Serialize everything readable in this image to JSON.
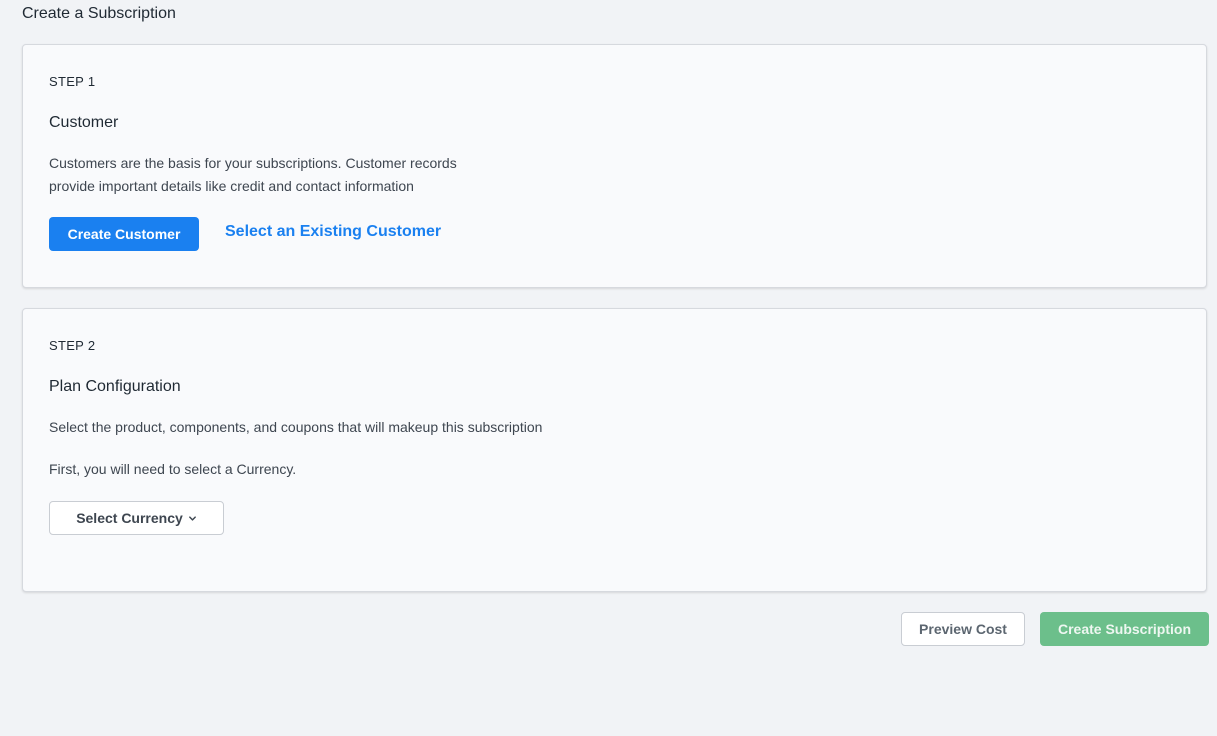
{
  "page": {
    "title": "Create a Subscription"
  },
  "step1": {
    "label": "STEP 1",
    "title": "Customer",
    "description_line1": "Customers are the basis for your subscriptions. Customer records",
    "description_line2": "provide important details like credit and contact information",
    "create_button": "Create Customer",
    "select_link": "Select an Existing Customer"
  },
  "step2": {
    "label": "STEP 2",
    "title": "Plan Configuration",
    "description": "Select the product, components, and coupons that will makeup this subscription",
    "currency_note": "First, you will need to select a Currency.",
    "currency_dropdown": "Select Currency",
    "currency_dropdown_icon": "chevron-down-icon"
  },
  "footer": {
    "preview_button": "Preview Cost",
    "create_button": "Create Subscription"
  },
  "colors": {
    "primary": "#1a80f0",
    "success_disabled": "#6cbf8b",
    "background": "#f1f3f6"
  }
}
